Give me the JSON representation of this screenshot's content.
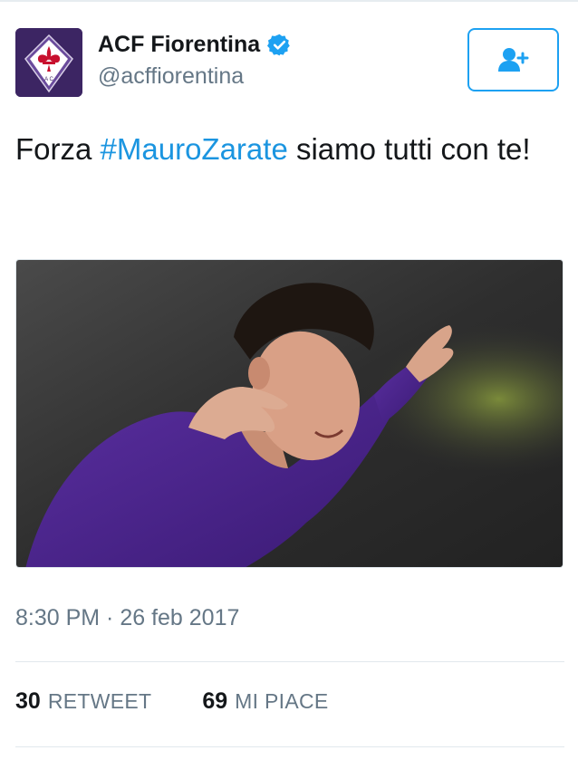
{
  "author": {
    "display_name": "ACF Fiorentina",
    "handle": "@acffiorentina",
    "verified": true,
    "avatar_icon": "fiorentina-crest-icon",
    "avatar_crest_text": "A C"
  },
  "follow_button": {
    "icon": "add-user-icon",
    "color": "#1da1f2"
  },
  "tweet": {
    "text_before": "Forza ",
    "hashtag": "#MauroZarate",
    "text_after": " siamo tutti con te!",
    "hashtag_color": "#1b95e0"
  },
  "media": {
    "type": "photo"
  },
  "timestamp": "8:30 PM · 26 feb 2017",
  "stats": {
    "retweets": {
      "count": "30",
      "label": "RETWEET"
    },
    "likes": {
      "count": "69",
      "label": "MI PIACE"
    }
  },
  "colors": {
    "text_primary": "#14171a",
    "text_secondary": "#657786",
    "accent": "#1da1f2",
    "divider": "#e1e8ed"
  }
}
